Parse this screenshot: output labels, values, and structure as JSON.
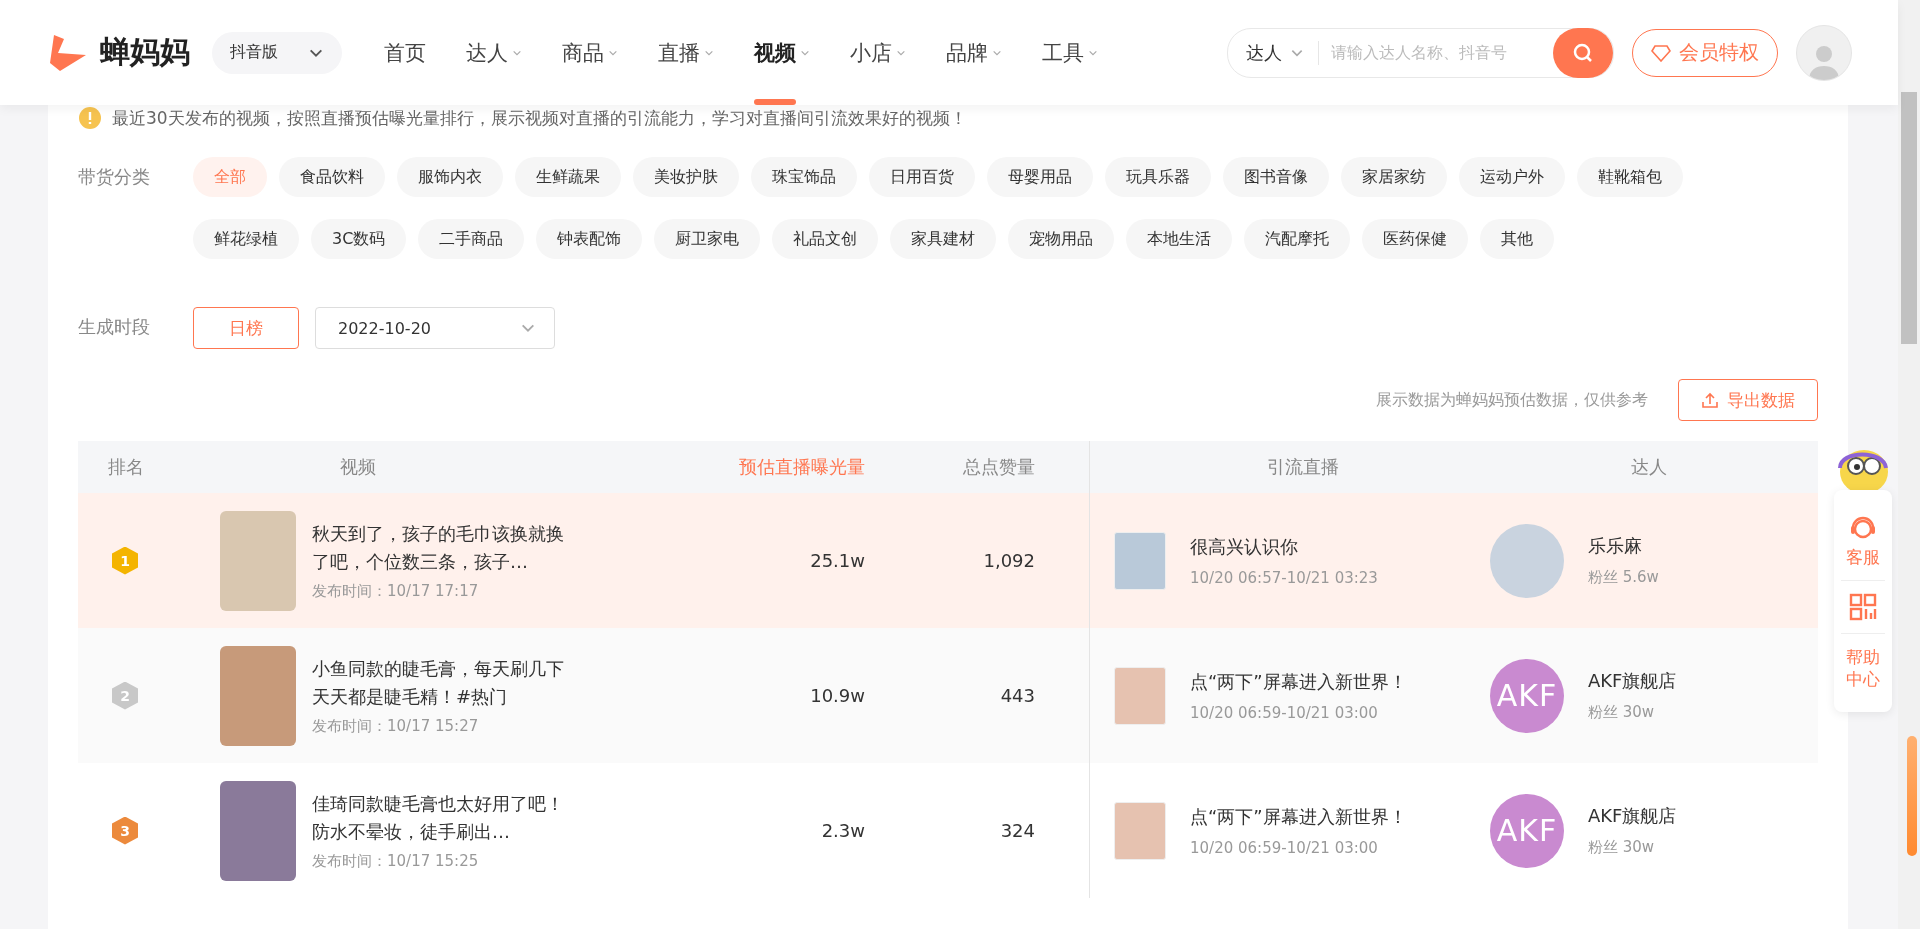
{
  "header": {
    "logo_text": "蝉妈妈",
    "platform": "抖音版",
    "nav": [
      {
        "label": "首页",
        "has_menu": false,
        "selected": false
      },
      {
        "label": "达人",
        "has_menu": true,
        "selected": false
      },
      {
        "label": "商品",
        "has_menu": true,
        "selected": false
      },
      {
        "label": "直播",
        "has_menu": true,
        "selected": false
      },
      {
        "label": "视频",
        "has_menu": true,
        "selected": true
      },
      {
        "label": "小店",
        "has_menu": true,
        "selected": false
      },
      {
        "label": "品牌",
        "has_menu": true,
        "selected": false
      },
      {
        "label": "工具",
        "has_menu": true,
        "selected": false
      }
    ],
    "search": {
      "scope": "达人",
      "placeholder": "请输入达人名称、抖音号"
    },
    "vip_button": "会员特权"
  },
  "notice": "最近30天发布的视频，按照直播预估曝光量排行，展示视频对直播的引流能力，学习对直播间引流效果好的视频！",
  "category_filter": {
    "label": "带货分类",
    "items": [
      {
        "label": "全部",
        "selected": true
      },
      {
        "label": "食品饮料",
        "selected": false
      },
      {
        "label": "服饰内衣",
        "selected": false
      },
      {
        "label": "生鲜蔬果",
        "selected": false
      },
      {
        "label": "美妆护肤",
        "selected": false
      },
      {
        "label": "珠宝饰品",
        "selected": false
      },
      {
        "label": "日用百货",
        "selected": false
      },
      {
        "label": "母婴用品",
        "selected": false
      },
      {
        "label": "玩具乐器",
        "selected": false
      },
      {
        "label": "图书音像",
        "selected": false
      },
      {
        "label": "家居家纺",
        "selected": false
      },
      {
        "label": "运动户外",
        "selected": false
      },
      {
        "label": "鞋靴箱包",
        "selected": false
      },
      {
        "label": "鲜花绿植",
        "selected": false
      },
      {
        "label": "3C数码",
        "selected": false
      },
      {
        "label": "二手商品",
        "selected": false
      },
      {
        "label": "钟表配饰",
        "selected": false
      },
      {
        "label": "厨卫家电",
        "selected": false
      },
      {
        "label": "礼品文创",
        "selected": false
      },
      {
        "label": "家具建材",
        "selected": false
      },
      {
        "label": "宠物用品",
        "selected": false
      },
      {
        "label": "本地生活",
        "selected": false
      },
      {
        "label": "汽配摩托",
        "selected": false
      },
      {
        "label": "医药保健",
        "selected": false
      },
      {
        "label": "其他",
        "selected": false
      }
    ]
  },
  "period_filter": {
    "label": "生成时段",
    "options": [
      {
        "label": "日榜",
        "selected": true
      }
    ],
    "date": "2022-10-20"
  },
  "disclaimer": "展示数据为蝉妈妈预估数据，仅供参考",
  "export_button": "导出数据",
  "table": {
    "columns": [
      {
        "label": "排名",
        "sorted": false
      },
      {
        "label": "视频",
        "sorted": false
      },
      {
        "label": "预估直播曝光量",
        "sorted": true
      },
      {
        "label": "总点赞量",
        "sorted": false
      },
      {
        "label": "引流直播",
        "sorted": false
      },
      {
        "label": "达人",
        "sorted": false
      }
    ],
    "rows": [
      {
        "rank": "1",
        "color": "#f4b400",
        "selected": true,
        "title": "秋天到了，孩子的毛巾该换就换了吧，个位数三条，孩子…",
        "published": "发布时间：10/17 17:17",
        "exposure": "25.1w",
        "likes": "1,092",
        "live_title": "很高兴认识你",
        "live_time": "10/20 06:57-10/21 03:23",
        "influencer": "乐乐麻",
        "followers": "粉丝 5.6w"
      },
      {
        "rank": "2",
        "color": "#c8c8c8",
        "selected": false,
        "title": "小鱼同款的睫毛膏，每天刷几下天天都是睫毛精！#热门",
        "published": "发布时间：10/17 15:27",
        "exposure": "10.9w",
        "likes": "443",
        "live_title": "点“两下”屏幕进入新世界！",
        "live_time": "10/20 06:59-10/21 03:00",
        "influencer": "AKF旗舰店",
        "followers": "粉丝 30w",
        "avatar_text": "AKF"
      },
      {
        "rank": "3",
        "color": "#ec8a3c",
        "selected": false,
        "title": "佳琦同款睫毛膏也太好用了吧！防水不晕妆，徒手刷出…",
        "published": "发布时间：10/17 15:25",
        "exposure": "2.3w",
        "likes": "324",
        "live_title": "点“两下”屏幕进入新世界！",
        "live_time": "10/20 06:59-10/21 03:00",
        "influencer": "AKF旗舰店",
        "followers": "粉丝 30w",
        "avatar_text": "AKF"
      }
    ]
  },
  "side_widget": {
    "items": [
      {
        "kind": "service",
        "label": "客服"
      },
      {
        "kind": "qr"
      },
      {
        "kind": "help",
        "label": "帮助中心"
      }
    ]
  }
}
